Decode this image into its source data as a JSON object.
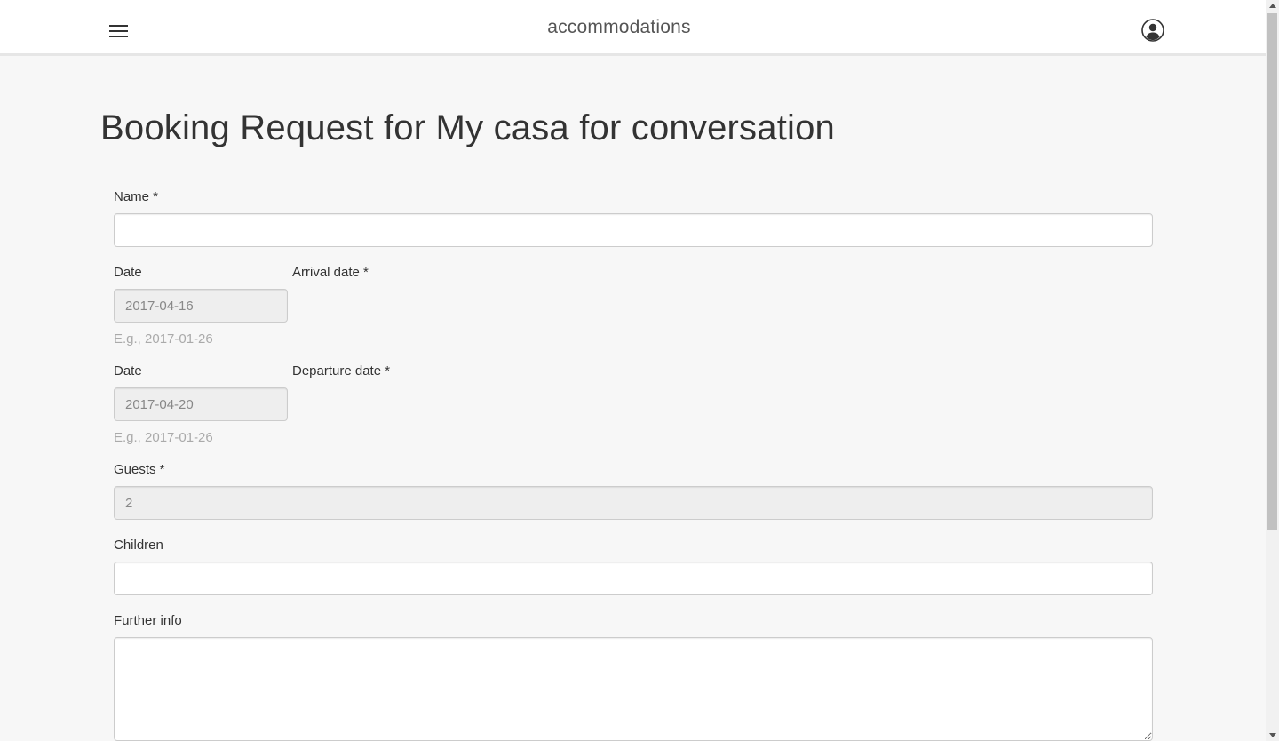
{
  "header": {
    "brand": "accommodations",
    "menu_icon": "hamburger-menu-icon",
    "user_icon": "user-account-icon"
  },
  "page": {
    "title": "Booking Request for My casa for conversation"
  },
  "form": {
    "name": {
      "label": "Name *",
      "value": ""
    },
    "arrival": {
      "date_label": "Date",
      "value": "2017-04-16",
      "label": "Arrival date *",
      "help": "E.g., 2017-01-26"
    },
    "departure": {
      "date_label": "Date",
      "value": "2017-04-20",
      "label": "Departure date *",
      "help": "E.g., 2017-01-26"
    },
    "guests": {
      "label": "Guests *",
      "value": "2"
    },
    "children": {
      "label": "Children",
      "value": ""
    },
    "further_info": {
      "label": "Further info",
      "value": ""
    }
  },
  "colors": {
    "background": "#f7f7f7",
    "header_bg": "#ffffff",
    "disabled_input_bg": "#eeeeee",
    "help_text": "#aaaaaa"
  }
}
